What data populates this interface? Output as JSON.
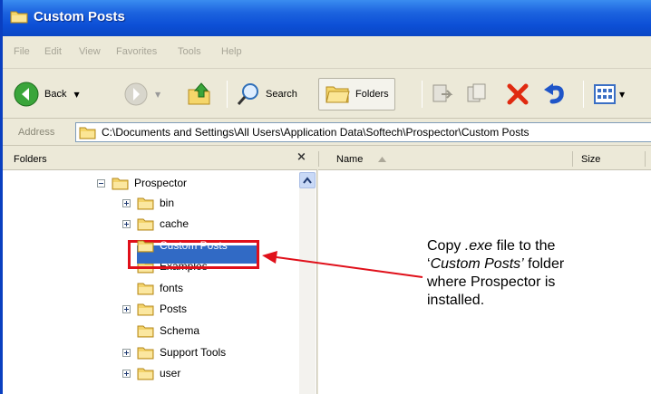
{
  "window": {
    "title": "Custom Posts"
  },
  "menu": [
    "File",
    "Edit",
    "View",
    "Favorites",
    "Tools",
    "Help"
  ],
  "toolbar": {
    "back_label": "Back",
    "search_label": "Search",
    "folders_label": "Folders"
  },
  "address": {
    "label": "Address",
    "path": "C:\\Documents and Settings\\All Users\\Application Data\\Softech\\Prospector\\Custom Posts"
  },
  "folders_pane": {
    "title": "Folders",
    "close": "×",
    "tree": [
      {
        "label": "Prospector",
        "expander": "minus"
      },
      {
        "label": "bin",
        "expander": "plus"
      },
      {
        "label": "cache",
        "expander": "plus"
      },
      {
        "label": "Custom Posts",
        "expander": "none",
        "selected": true
      },
      {
        "label": "Examples",
        "expander": "none"
      },
      {
        "label": "fonts",
        "expander": "none"
      },
      {
        "label": "Posts",
        "expander": "plus"
      },
      {
        "label": "Schema",
        "expander": "none"
      },
      {
        "label": "Support Tools",
        "expander": "plus"
      },
      {
        "label": "user",
        "expander": "plus"
      }
    ]
  },
  "content": {
    "col_name": "Name",
    "col_size": "Size"
  },
  "callout": {
    "line1_prefix": "Copy ",
    "line1_ext": ".exe",
    "line1_suffix": " file to the",
    "line2_open": "‘",
    "line2_folder": "Custom Posts’",
    "line2_suffix": " folder",
    "line3": "where Prospector is",
    "line4": "installed."
  },
  "colors": {
    "title_bar": "#0c4fd6",
    "highlight": "#e0101a",
    "selection": "#316ac5"
  }
}
